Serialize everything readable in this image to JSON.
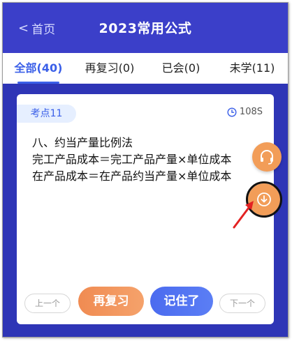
{
  "header": {
    "back_label": "首页",
    "title": "2023常用公式"
  },
  "tabs": [
    {
      "label": "全部(40)",
      "active": true
    },
    {
      "label": "再复习(0)",
      "active": false
    },
    {
      "label": "已会(0)",
      "active": false
    },
    {
      "label": "未学(11)",
      "active": false
    }
  ],
  "card": {
    "badge": "考点11",
    "timer": "108S",
    "lines": [
      "八、约当产量比例法",
      "完工产品成本＝完工产品产量×单位成本",
      "在产品成本＝在产品约当产量×单位成本"
    ]
  },
  "floating": {
    "support_icon": "headset-icon",
    "download_icon": "download-icon"
  },
  "footer": {
    "prev_label": "上一个",
    "review_label": "再复习",
    "remember_label": "记住了",
    "next_label": "下一个"
  },
  "colors": {
    "header_bg": "#3b3fc9",
    "body_bg": "#2e35b6",
    "accent_blue": "#3a5fe8",
    "accent_orange": "#f29d58",
    "annotation_red": "#e32222"
  }
}
